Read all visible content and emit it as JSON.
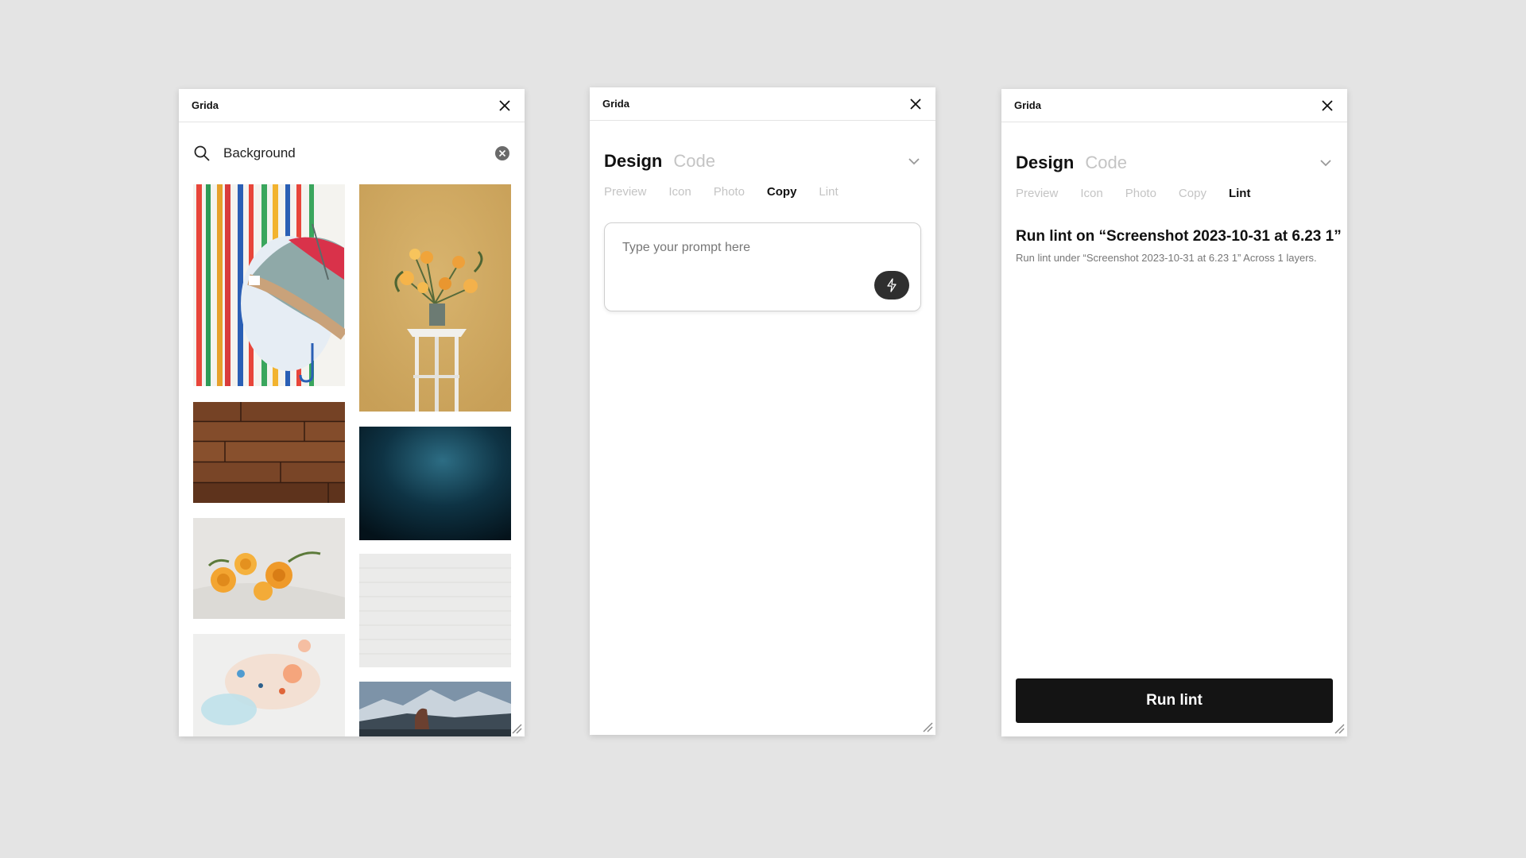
{
  "panels": [
    {
      "title": "Grida",
      "search": {
        "value": "Background"
      }
    },
    {
      "title": "Grida",
      "modes": {
        "active": "Design",
        "inactive": "Code"
      },
      "tabs": [
        "Preview",
        "Icon",
        "Photo",
        "Copy",
        "Lint"
      ],
      "active_tab": "Copy",
      "prompt": {
        "placeholder": "Type your prompt here",
        "value": ""
      }
    },
    {
      "title": "Grida",
      "modes": {
        "active": "Design",
        "inactive": "Code"
      },
      "tabs": [
        "Preview",
        "Icon",
        "Photo",
        "Copy",
        "Lint"
      ],
      "active_tab": "Lint",
      "lint": {
        "heading": "Run lint on “Screenshot 2023-10-31 at 6.23 1”",
        "description": "Run lint under “Screenshot 2023-10-31 at 6.23 1” Across 1 layers.",
        "button": "Run lint"
      }
    }
  ],
  "colors": {
    "background": "#e4e4e4",
    "panel": "#ffffff",
    "accent_dark": "#141414",
    "muted": "#c4c4c4"
  }
}
